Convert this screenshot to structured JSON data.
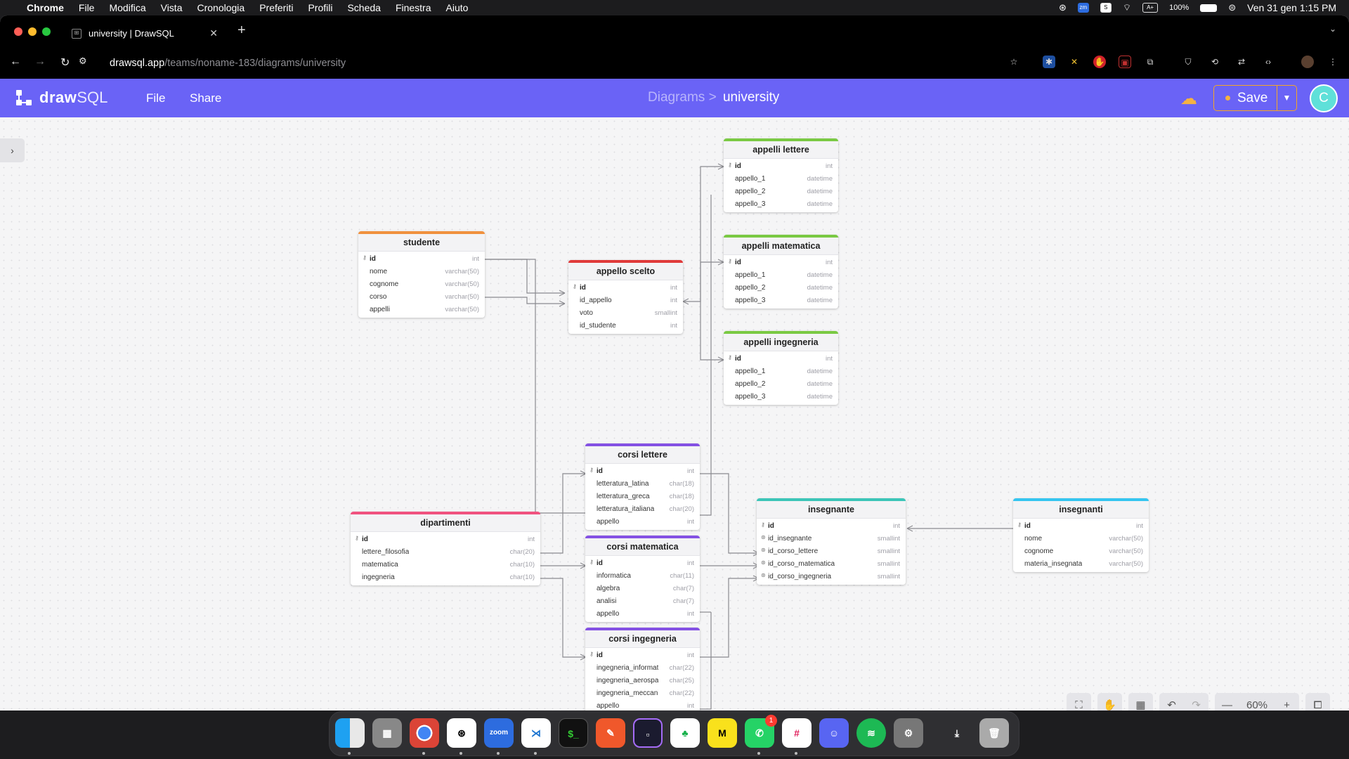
{
  "menubar": {
    "app": "Chrome",
    "items": [
      "File",
      "Modifica",
      "Vista",
      "Cronologia",
      "Preferiti",
      "Profili",
      "Scheda",
      "Finestra",
      "Aiuto"
    ],
    "battery": "100%",
    "ax": "A+",
    "zm": "zm",
    "datetime": "Ven 31 gen  1:15 PM"
  },
  "tab": {
    "title": "university | DrawSQL"
  },
  "url": {
    "host": "drawsql.app",
    "path": "/teams/noname-183/diagrams/university"
  },
  "app": {
    "logo_bold": "draw",
    "logo_light": "SQL",
    "menu": [
      "File",
      "Share"
    ],
    "breadcrumb_parent": "Diagrams",
    "breadcrumb_sep": ">",
    "breadcrumb_current": "university",
    "save_label": "Save",
    "avatar_initial": "C"
  },
  "zoom": "60%",
  "colors": {
    "brand": "#6a63f6",
    "orange": "#f0913e",
    "red": "#e03a3a",
    "green": "#7ac943",
    "purple": "#8451e3",
    "pink": "#f0527f",
    "teal": "#3cc5b8",
    "cyan": "#35c5f0"
  },
  "tables": [
    {
      "name": "studente",
      "rows": [
        {
          "n": "id",
          "t": "int",
          "pk": true
        },
        {
          "n": "nome",
          "t": "varchar(50)"
        },
        {
          "n": "cognome",
          "t": "varchar(50)"
        },
        {
          "n": "corso",
          "t": "varchar(50)"
        },
        {
          "n": "appelli",
          "t": "varchar(50)"
        }
      ]
    },
    {
      "name": "appello scelto",
      "rows": [
        {
          "n": "id",
          "t": "int",
          "pk": true
        },
        {
          "n": "id_appello",
          "t": "int"
        },
        {
          "n": "voto",
          "t": "smallint"
        },
        {
          "n": "id_studente",
          "t": "int"
        }
      ]
    },
    {
      "name": "appelli lettere",
      "rows": [
        {
          "n": "id",
          "t": "int",
          "pk": true
        },
        {
          "n": "appello_1",
          "t": "datetime"
        },
        {
          "n": "appello_2",
          "t": "datetime"
        },
        {
          "n": "appello_3",
          "t": "datetime"
        }
      ]
    },
    {
      "name": "appelli matematica",
      "rows": [
        {
          "n": "id",
          "t": "int",
          "pk": true
        },
        {
          "n": "appello_1",
          "t": "datetime"
        },
        {
          "n": "appello_2",
          "t": "datetime"
        },
        {
          "n": "appello_3",
          "t": "datetime"
        }
      ]
    },
    {
      "name": "appelli ingegneria",
      "rows": [
        {
          "n": "id",
          "t": "int",
          "pk": true
        },
        {
          "n": "appello_1",
          "t": "datetime"
        },
        {
          "n": "appello_2",
          "t": "datetime"
        },
        {
          "n": "appello_3",
          "t": "datetime"
        }
      ]
    },
    {
      "name": "corsi lettere",
      "rows": [
        {
          "n": "id",
          "t": "int",
          "pk": true
        },
        {
          "n": "letteratura_latina",
          "t": "char(18)"
        },
        {
          "n": "letteratura_greca",
          "t": "char(18)"
        },
        {
          "n": "letteratura_italiana",
          "t": "char(20)"
        },
        {
          "n": "appello",
          "t": "int"
        }
      ]
    },
    {
      "name": "corsi matematica",
      "rows": [
        {
          "n": "id",
          "t": "int",
          "pk": true
        },
        {
          "n": "informatica",
          "t": "char(11)"
        },
        {
          "n": "algebra",
          "t": "char(7)"
        },
        {
          "n": "analisi",
          "t": "char(7)"
        },
        {
          "n": "appello",
          "t": "int"
        }
      ]
    },
    {
      "name": "corsi ingegneria",
      "rows": [
        {
          "n": "id",
          "t": "int",
          "pk": true
        },
        {
          "n": "ingegneria_informatica",
          "t": "char(22)"
        },
        {
          "n": "ingegneria_aerospaziale",
          "t": "char(25)"
        },
        {
          "n": "ingegneria_meccanica",
          "t": "char(22)"
        },
        {
          "n": "appello",
          "t": "int"
        }
      ]
    },
    {
      "name": "dipartimenti",
      "rows": [
        {
          "n": "id",
          "t": "int",
          "pk": true
        },
        {
          "n": "lettere_filosofia",
          "t": "char(20)"
        },
        {
          "n": "matematica",
          "t": "char(10)"
        },
        {
          "n": "ingegneria",
          "t": "char(10)"
        }
      ]
    },
    {
      "name": "insegnante",
      "rows": [
        {
          "n": "id",
          "t": "int",
          "pk": true
        },
        {
          "n": "id_insegnante",
          "t": "smallint",
          "uk": true
        },
        {
          "n": "id_corso_lettere",
          "t": "smallint",
          "uk": true
        },
        {
          "n": "id_corso_matematica",
          "t": "smallint",
          "uk": true
        },
        {
          "n": "id_corso_ingegneria",
          "t": "smallint",
          "uk": true
        }
      ]
    },
    {
      "name": "insegnanti",
      "rows": [
        {
          "n": "id",
          "t": "int",
          "pk": true
        },
        {
          "n": "nome",
          "t": "varchar(50)"
        },
        {
          "n": "cognome",
          "t": "varchar(50)"
        },
        {
          "n": "materia_insegnata",
          "t": "varchar(50)"
        }
      ]
    }
  ]
}
